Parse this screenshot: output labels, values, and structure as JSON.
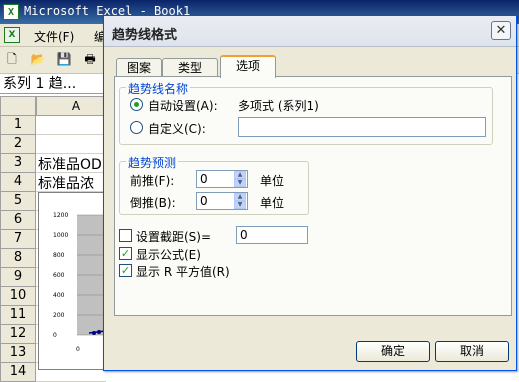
{
  "excel": {
    "title": "Microsoft Excel - Book1",
    "menu": {
      "file": "文件(F)",
      "edit_partial": "编"
    },
    "namebox": "系列 1 趋...",
    "column_a": "A",
    "rows": [
      "1",
      "2",
      "3",
      "4",
      "5",
      "6",
      "7",
      "8",
      "9",
      "10",
      "11",
      "12",
      "13",
      "14"
    ],
    "cells": {
      "a3": "标准品OD",
      "a4": "标准品浓"
    },
    "mini_chart": {
      "yticks": [
        "1200",
        "1000",
        "800",
        "600",
        "400",
        "200",
        "0"
      ],
      "x0": "0"
    }
  },
  "dialog": {
    "title": "趋势线格式",
    "close": "✕",
    "tabs": [
      "图案",
      "类型",
      "选项"
    ],
    "active_tab": 2,
    "name_group": {
      "title": "趋势线名称",
      "auto_label": "自动设置(A):",
      "auto_value": "多项式 (系列1)",
      "custom_label": "自定义(C):",
      "custom_value": ""
    },
    "forecast_group": {
      "title": "趋势预测",
      "forward_label": "前推(F):",
      "forward_value": "0",
      "backward_label": "倒推(B):",
      "backward_value": "0",
      "unit": "单位"
    },
    "options": {
      "intercept_label": "设置截距(S)=",
      "intercept_value": "0",
      "intercept_checked": false,
      "show_equation_label": "显示公式(E)",
      "show_equation_checked": true,
      "show_r2_label": "显示 R 平方值(R)",
      "show_r2_checked": true
    },
    "ok": "确定",
    "cancel": "取消"
  }
}
